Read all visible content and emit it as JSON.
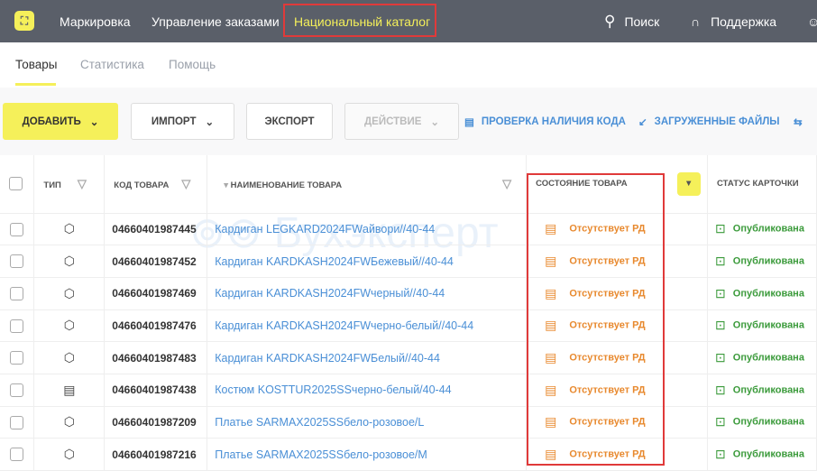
{
  "topbar": {
    "nav": [
      "Маркировка",
      "Управление заказами",
      "Национальный каталог"
    ],
    "search": "Поиск",
    "support": "Поддержка"
  },
  "subnav": {
    "tabs": [
      "Товары",
      "Статистика",
      "Помощь"
    ]
  },
  "toolbar": {
    "add": "ДОБАВИТЬ",
    "import": "ИМПОРТ",
    "export": "ЭКСПОРТ",
    "action": "ДЕЙСТВИЕ",
    "check_code": "ПРОВЕРКА НАЛИЧИЯ КОДА",
    "uploaded": "ЗАГРУЖЕННЫЕ ФАЙЛЫ"
  },
  "watermark": "БухЭксперт",
  "table": {
    "headers": {
      "type": "ТИП",
      "code": "КОД ТОВАРА",
      "name": "НАИМЕНОВАНИЕ ТОВАРА",
      "state": "СОСТОЯНИЕ ТОВАРА",
      "status": "СТАТУС КАРТОЧКИ"
    },
    "rows": [
      {
        "type": "box",
        "code": "04660401987445",
        "name": "Кардиган LEGKARD2024FWайвори//40-44",
        "state": "Отсутствует РД",
        "status": "Опубликована"
      },
      {
        "type": "box",
        "code": "04660401987452",
        "name": "Кардиган KARDKASH2024FWБежевый//40-44",
        "state": "Отсутствует РД",
        "status": "Опубликована"
      },
      {
        "type": "box",
        "code": "04660401987469",
        "name": "Кардиган KARDKASH2024FWчерный//40-44",
        "state": "Отсутствует РД",
        "status": "Опубликована"
      },
      {
        "type": "box",
        "code": "04660401987476",
        "name": "Кардиган KARDKASH2024FWчерно-белый//40-44",
        "state": "Отсутствует РД",
        "status": "Опубликована"
      },
      {
        "type": "box",
        "code": "04660401987483",
        "name": "Кардиган KARDKASH2024FWБелый//40-44",
        "state": "Отсутствует РД",
        "status": "Опубликована"
      },
      {
        "type": "list",
        "code": "04660401987438",
        "name": "Костюм KOSTTUR2025SSчерно-белый/40-44",
        "state": "Отсутствует РД",
        "status": "Опубликована"
      },
      {
        "type": "box",
        "code": "04660401987209",
        "name": "Платье SARMAX2025SSбело-розовое/L",
        "state": "Отсутствует РД",
        "status": "Опубликована"
      },
      {
        "type": "box",
        "code": "04660401987216",
        "name": "Платье SARMAX2025SSбело-розовое/M",
        "state": "Отсутствует РД",
        "status": "Опубликована"
      }
    ]
  }
}
